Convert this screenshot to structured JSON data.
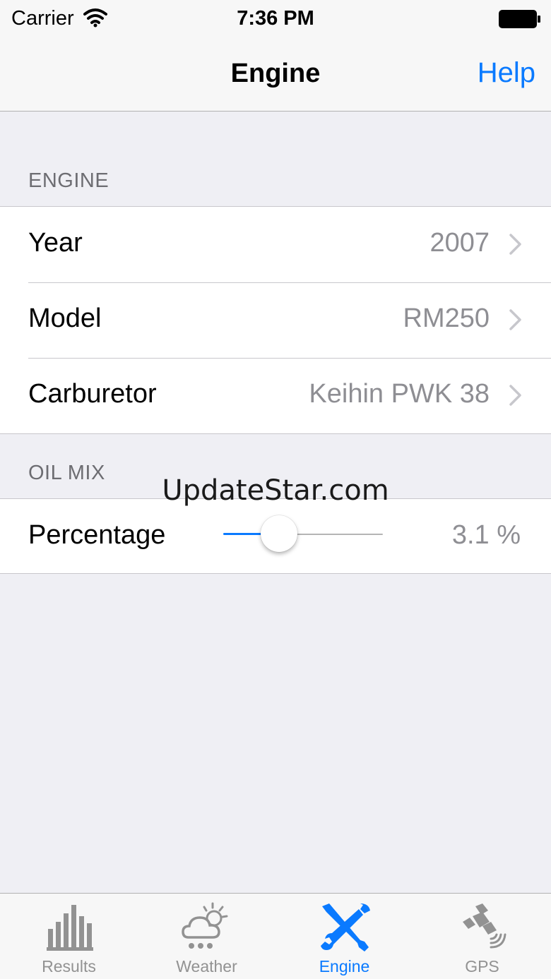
{
  "status_bar": {
    "carrier": "Carrier",
    "time": "7:36 PM"
  },
  "nav": {
    "title": "Engine",
    "help_label": "Help"
  },
  "sections": {
    "engine": {
      "header": "ENGINE",
      "rows": [
        {
          "label": "Year",
          "value": "2007"
        },
        {
          "label": "Model",
          "value": "RM250"
        },
        {
          "label": "Carburetor",
          "value": "Keihin PWK 38"
        }
      ]
    },
    "oil_mix": {
      "header": "OIL MIX",
      "percentage_label": "Percentage",
      "percentage_value": "3.1 %",
      "slider_fraction": 0.35
    }
  },
  "watermark": "UpdateStar.com",
  "tabs": [
    {
      "label": "Results",
      "icon": "bar-chart-icon",
      "active": false
    },
    {
      "label": "Weather",
      "icon": "weather-icon",
      "active": false
    },
    {
      "label": "Engine",
      "icon": "wrench-screwdriver-icon",
      "active": true
    },
    {
      "label": "GPS",
      "icon": "satellite-icon",
      "active": false
    }
  ],
  "colors": {
    "accent": "#0a7aff",
    "inactive": "#929292",
    "secondary_text": "#8e8e93"
  }
}
